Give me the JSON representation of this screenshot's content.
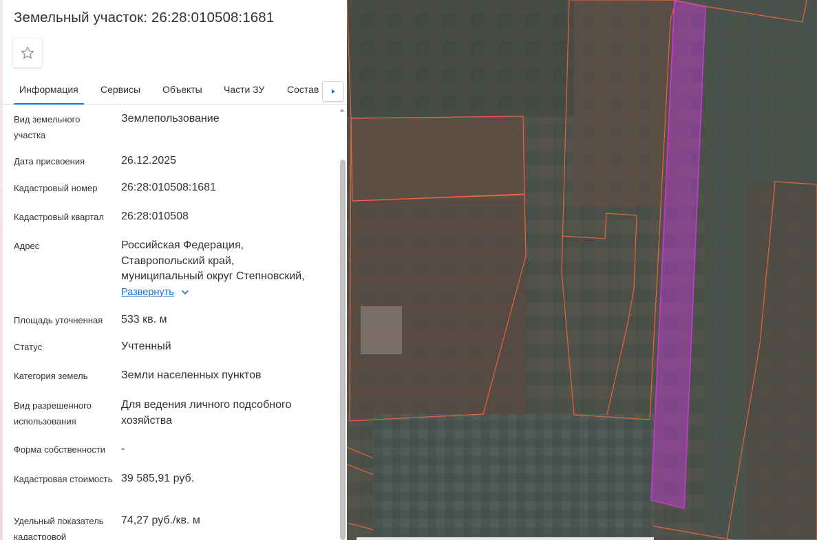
{
  "header": {
    "title": "Земельный участок: 26:28:010508:1681"
  },
  "favorite": {
    "icon": "star-outline-icon"
  },
  "tabs": [
    {
      "label": "Информация",
      "active": true
    },
    {
      "label": "Сервисы",
      "active": false
    },
    {
      "label": "Объекты",
      "active": false
    },
    {
      "label": "Части ЗУ",
      "active": false
    },
    {
      "label": "Состав",
      "active": false
    }
  ],
  "tabs_next_icon": "caret-right-icon",
  "info": {
    "land_type": {
      "label": "Вид земельного участка",
      "value": "Землепользование"
    },
    "assign_date": {
      "label": "Дата присвоения",
      "value": "26.12.2025"
    },
    "cad_number": {
      "label": "Кадастровый номер",
      "value": "26:28:010508:1681"
    },
    "cad_quarter": {
      "label": "Кадастровый квартал",
      "value": "26:28:010508"
    },
    "address": {
      "label": "Адрес",
      "line1": "Российская Федерация,",
      "line2": "Ставропольский край,",
      "line3": "муниципальный округ Степновский,",
      "expand": "Развернуть"
    },
    "area": {
      "label": "Площадь уточненная",
      "value": "533 кв. м"
    },
    "status": {
      "label": "Статус",
      "value": "Учтенный"
    },
    "category": {
      "label": "Категория земель",
      "value": "Земли населенных пунктов"
    },
    "permitted_use": {
      "label": "Вид разрешенного использования",
      "value": "Для ведения личного подсобного хозяйства"
    },
    "ownership": {
      "label": "Форма собственности",
      "value": "-"
    },
    "cad_value": {
      "label": "Кадастровая стоимость",
      "value": "39 585,91 руб."
    },
    "specific_value": {
      "label": "Удельный показатель кадастровой",
      "value": "74,27 руб./кв. м"
    }
  },
  "map": {
    "parcel_border_color": "#e8643a",
    "selected_parcel_color": "#c43ad6"
  }
}
